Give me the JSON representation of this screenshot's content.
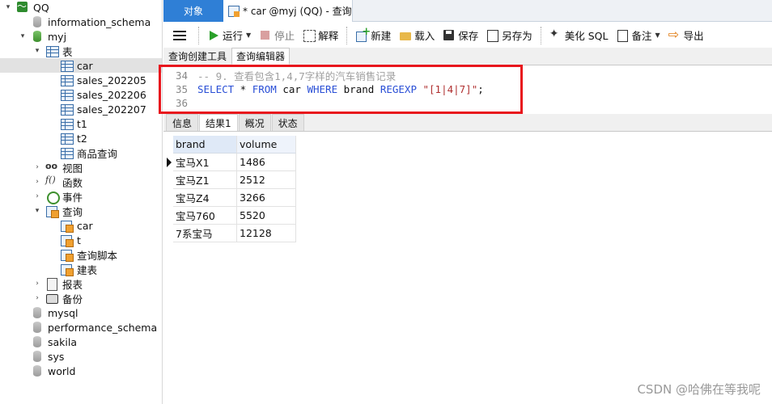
{
  "sidebar": {
    "items": [
      {
        "label": "QQ",
        "icon": "connection-icon",
        "arrow": "▾",
        "level": 0
      },
      {
        "label": "information_schema",
        "icon": "database-icon",
        "arrow": "",
        "level": 1
      },
      {
        "label": "myj",
        "icon": "database-icon",
        "arrow": "▾",
        "level": 1
      },
      {
        "label": "表",
        "icon": "table-group-icon",
        "arrow": "▾",
        "level": 2
      },
      {
        "label": "car",
        "icon": "table-icon",
        "arrow": "",
        "level": 3,
        "selected": true
      },
      {
        "label": "sales_202205",
        "icon": "table-icon",
        "arrow": "",
        "level": 3
      },
      {
        "label": "sales_202206",
        "icon": "table-icon",
        "arrow": "",
        "level": 3
      },
      {
        "label": "sales_202207",
        "icon": "table-icon",
        "arrow": "",
        "level": 3
      },
      {
        "label": "t1",
        "icon": "table-icon",
        "arrow": "",
        "level": 3
      },
      {
        "label": "t2",
        "icon": "table-icon",
        "arrow": "",
        "level": 3
      },
      {
        "label": "商品查询",
        "icon": "table-icon",
        "arrow": "",
        "level": 3
      },
      {
        "label": "视图",
        "icon": "view-icon",
        "arrow": "›",
        "level": 2
      },
      {
        "label": "函数",
        "icon": "function-icon",
        "arrow": "›",
        "level": 2
      },
      {
        "label": "事件",
        "icon": "event-icon",
        "arrow": "›",
        "level": 2
      },
      {
        "label": "查询",
        "icon": "query-group-icon",
        "arrow": "▾",
        "level": 2
      },
      {
        "label": "car",
        "icon": "query-icon",
        "arrow": "",
        "level": 3
      },
      {
        "label": "t",
        "icon": "query-icon",
        "arrow": "",
        "level": 3
      },
      {
        "label": "查询脚本",
        "icon": "query-icon",
        "arrow": "",
        "level": 3
      },
      {
        "label": "建表",
        "icon": "query-icon",
        "arrow": "",
        "level": 3
      },
      {
        "label": "报表",
        "icon": "report-icon",
        "arrow": "›",
        "level": 2
      },
      {
        "label": "备份",
        "icon": "backup-icon",
        "arrow": "›",
        "level": 2
      },
      {
        "label": "mysql",
        "icon": "database-icon",
        "arrow": "",
        "level": 1
      },
      {
        "label": "performance_schema",
        "icon": "database-icon",
        "arrow": "",
        "level": 1
      },
      {
        "label": "sakila",
        "icon": "database-icon",
        "arrow": "",
        "level": 1
      },
      {
        "label": "sys",
        "icon": "database-icon",
        "arrow": "",
        "level": 1
      },
      {
        "label": "world",
        "icon": "database-icon",
        "arrow": "",
        "level": 1
      }
    ]
  },
  "tabs": {
    "objects": "对象",
    "query": "* car @myj (QQ) - 查询"
  },
  "toolbar": {
    "run": "运行",
    "stop": "停止",
    "explain": "解释",
    "new": "新建",
    "load": "载入",
    "save": "保存",
    "save_as": "另存为",
    "beautify": "美化 SQL",
    "note": "备注",
    "export": "导出"
  },
  "subtabs": {
    "builder": "查询创建工具",
    "editor": "查询编辑器"
  },
  "editor": {
    "lines": [
      {
        "num": "34",
        "comment": "-- 9. 查看包含1,4,7字样的汽车销售记录"
      },
      {
        "num": "35",
        "select": "SELECT",
        "star": " * ",
        "from": "FROM",
        "table": " car ",
        "where": "WHERE",
        "column": " brand ",
        "regexp": "REGEXP",
        "pattern": " \"[1|4|7]\"",
        "end": ";"
      },
      {
        "num": "36"
      }
    ]
  },
  "result_tabs": [
    "信息",
    "结果1",
    "概况",
    "状态"
  ],
  "grid": {
    "columns": [
      "brand",
      "volume"
    ],
    "rows": [
      [
        "宝马X1",
        "1486"
      ],
      [
        "宝马Z1",
        "2512"
      ],
      [
        "宝马Z4",
        "3266"
      ],
      [
        "宝马760",
        "5520"
      ],
      [
        "7系宝马",
        "12128"
      ]
    ]
  },
  "watermark": "CSDN @哈佛在等我呢",
  "colors": {
    "accent_tab": "#2f7fd6",
    "highlight_border": "#e8161d",
    "keyword": "#2a4fd6",
    "string": "#b03030"
  }
}
